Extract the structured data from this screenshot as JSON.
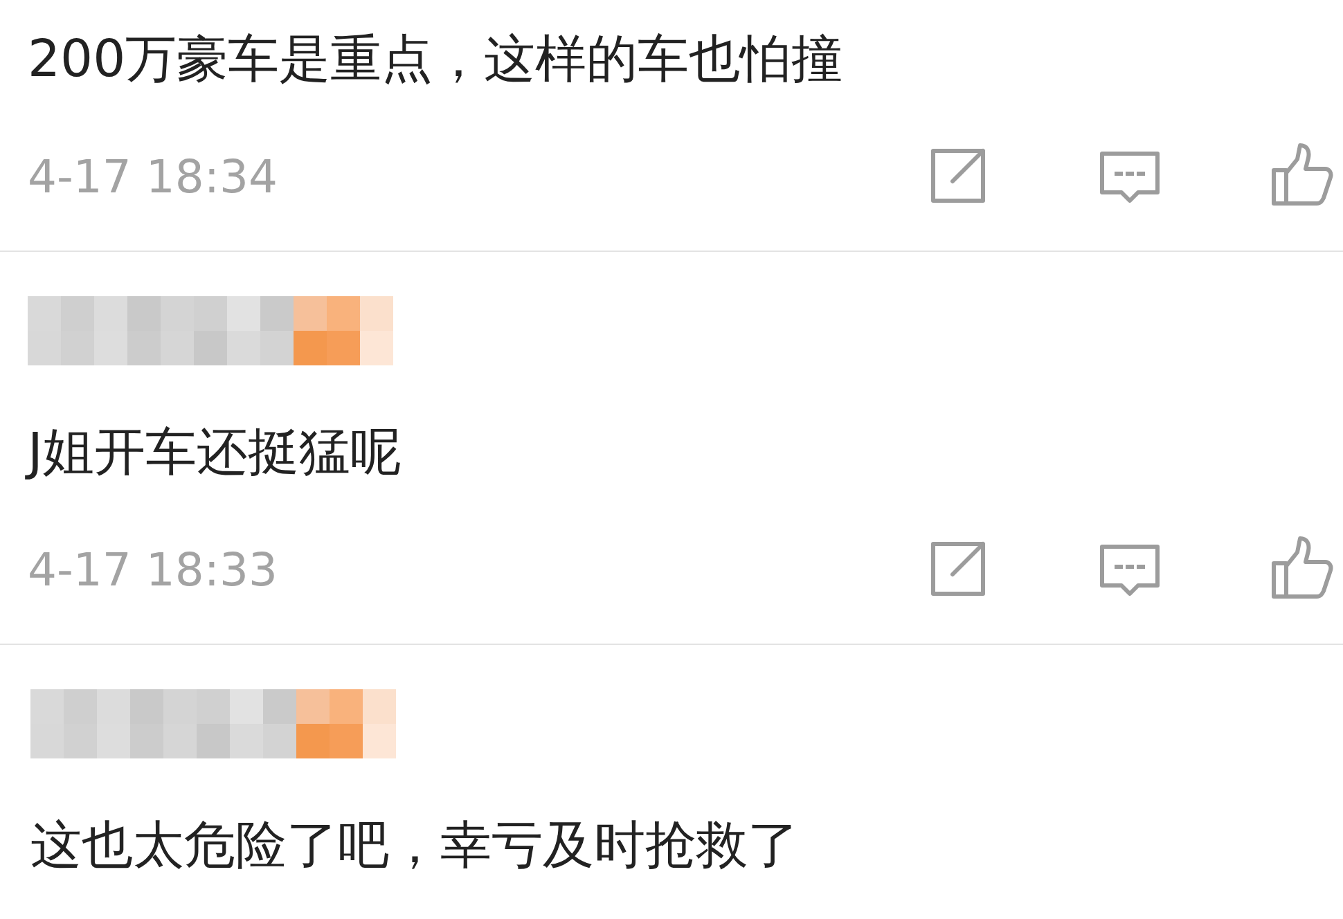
{
  "comments": [
    {
      "name_blurred": false,
      "text": "200万豪车是重点，这样的车也怕撞",
      "time": "4-17 18:34"
    },
    {
      "name_blurred": true,
      "text": "J姐开车还挺猛呢",
      "time": "4-17 18:33"
    },
    {
      "name_blurred": true,
      "text": "这也太危险了吧，幸亏及时抢救了"
    }
  ]
}
